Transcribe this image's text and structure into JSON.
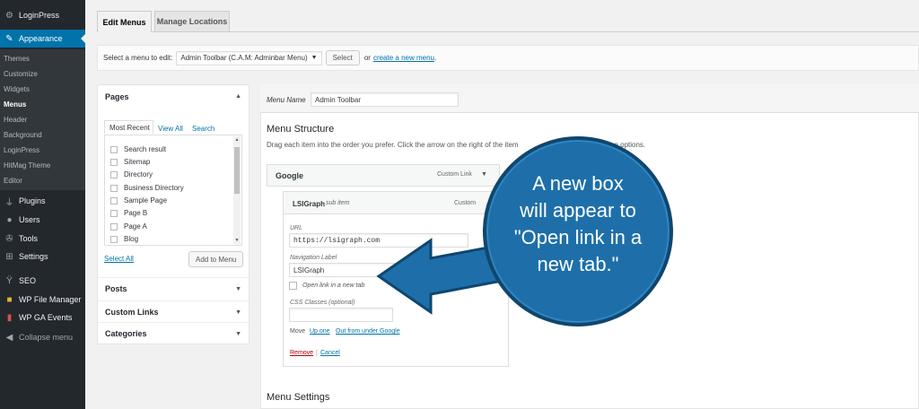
{
  "sidebar": {
    "items": [
      {
        "label": "LoginPress",
        "icon": "gear-icon"
      },
      {
        "label": "Appearance",
        "icon": "paintbrush-icon"
      },
      {
        "label": "Plugins",
        "icon": "plugin-icon"
      },
      {
        "label": "Users",
        "icon": "user-icon"
      },
      {
        "label": "Tools",
        "icon": "wrench-icon"
      },
      {
        "label": "Settings",
        "icon": "settings-icon"
      },
      {
        "label": "SEO",
        "icon": "yoast-icon"
      },
      {
        "label": "WP File Manager",
        "icon": "folder-icon"
      },
      {
        "label": "WP GA Events",
        "icon": "chart-icon"
      },
      {
        "label": "Collapse menu",
        "icon": "collapse-icon"
      }
    ],
    "submenu": [
      "Themes",
      "Customize",
      "Widgets",
      "Menus",
      "Header",
      "Background",
      "LoginPress",
      "HitMag Theme",
      "Editor"
    ]
  },
  "tabs": {
    "edit": "Edit Menus",
    "locations": "Manage Locations"
  },
  "manage": {
    "prompt": "Select a menu to edit:",
    "selected_menu": "Admin Toolbar (C.A.M: Adminbar Menu)",
    "select_button": "Select",
    "or_text": "or",
    "create_link": "create a new menu",
    "period": "."
  },
  "accordion": {
    "pages_title": "Pages",
    "inner_tabs": [
      "Most Recent",
      "View All",
      "Search"
    ],
    "pages": [
      "Search result",
      "Sitemap",
      "Directory",
      "Business Directory",
      "Sample Page",
      "Page B",
      "Page A",
      "Blog"
    ],
    "select_all": "Select All",
    "add_to_menu": "Add to Menu",
    "sections": [
      "Posts",
      "Custom Links",
      "Categories"
    ]
  },
  "editor": {
    "menu_name_label": "Menu Name",
    "menu_name_value": "Admin Toolbar",
    "structure_title": "Menu Structure",
    "structure_desc": "Drag each item into the order you prefer. Click the arrow on the right of the item",
    "structure_desc_tail": "on options.",
    "item_google": "Google",
    "item_google_type": "Custom Link",
    "sub_item_title": "LSIGraph",
    "sub_item_tag": "sub item",
    "sub_item_type": "Custom",
    "url_label": "URL",
    "url_value": "https://lsigraph.com",
    "nav_label": "Navigation Label",
    "nav_value": "LSIGraph",
    "open_new_tab": "Open link in a new tab",
    "css_label": "CSS Classes (optional)",
    "move_label": "Move",
    "move_up": "Up one",
    "move_out": "Out from under Google",
    "remove": "Remove",
    "separator": "|",
    "cancel": "Cancel",
    "settings_title": "Menu Settings"
  },
  "callout": {
    "lines": [
      "A new box",
      "will appear to",
      "\"Open link in a",
      "new tab.\""
    ]
  },
  "colors": {
    "accent": "#0073aa",
    "sidebar": "#23282d",
    "callout": "#1e6fa9"
  }
}
